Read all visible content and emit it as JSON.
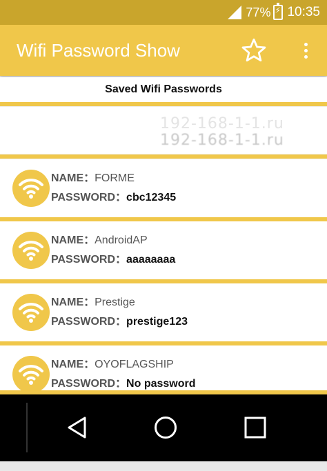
{
  "status_bar": {
    "battery": "77%",
    "time": "10:35"
  },
  "app_bar": {
    "title": "Wifi Password Show",
    "star_icon": "star-outline-icon",
    "menu_icon": "more-vert-icon"
  },
  "section": {
    "title": "Saved Wifi Passwords"
  },
  "watermark": {
    "line1": "192-168-1-1.ru",
    "line2": "192-168-1-1.ru"
  },
  "labels": {
    "name": "NAME：",
    "password": "PASSWORD："
  },
  "networks": [
    {
      "name": "FORME",
      "password": "cbc12345"
    },
    {
      "name": "AndroidAP",
      "password": "aaaaaaaa"
    },
    {
      "name": "Prestige",
      "password": "prestige123"
    },
    {
      "name": "OYOFLAGSHIP",
      "password": "No password"
    }
  ],
  "colors": {
    "accent": "#f0c74a",
    "status_bar": "#c9a52c",
    "nav_bar": "#000000"
  },
  "nav": {
    "back_icon": "back-triangle-icon",
    "home_icon": "home-circle-icon",
    "recents_icon": "recents-square-icon"
  }
}
